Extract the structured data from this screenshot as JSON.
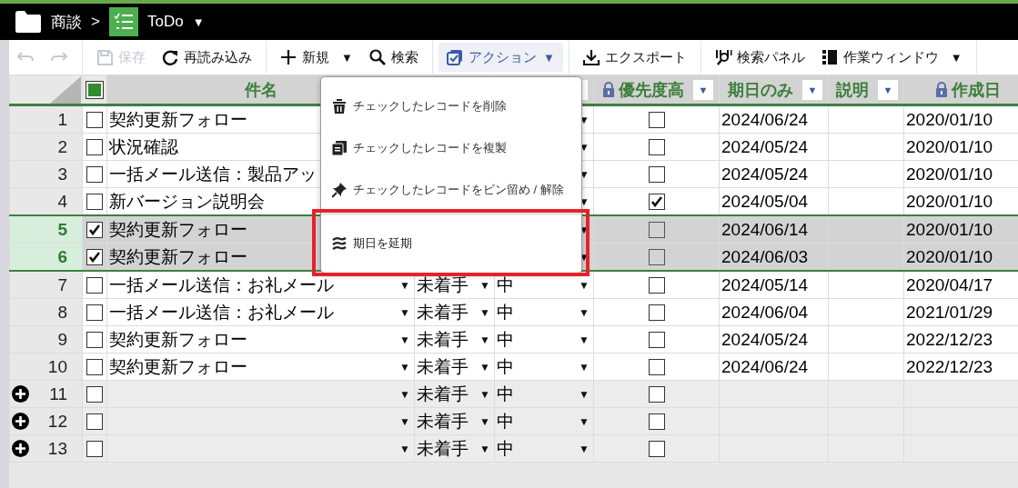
{
  "breadcrumb": {
    "site": "商談",
    "separator": ">",
    "table": "ToDo",
    "caret": "▼"
  },
  "toolbar": [
    {
      "kind": "undo",
      "disabled": true
    },
    {
      "kind": "redo",
      "disabled": true,
      "sep_after": true
    },
    {
      "kind": "save",
      "label": "保存",
      "disabled": true
    },
    {
      "kind": "reload",
      "label": "再読み込み",
      "disabled": false,
      "sep_after": true
    },
    {
      "kind": "new",
      "label": "新規",
      "caret": "▼",
      "disabled": false
    },
    {
      "kind": "search",
      "label": "検索",
      "disabled": false,
      "sep_after": true
    },
    {
      "kind": "action",
      "label": "アクション",
      "caret": "▼",
      "disabled": false,
      "active": true,
      "sep_after": true
    },
    {
      "kind": "export",
      "label": "エクスポート",
      "disabled": false,
      "sep_after": true
    },
    {
      "kind": "panel",
      "label": "検索パネル",
      "disabled": false
    },
    {
      "kind": "window",
      "label": "作業ウィンドウ",
      "caret": "▼",
      "disabled": false,
      "sep_after": true
    }
  ],
  "header_checkbox": {
    "partial": true
  },
  "columns": [
    {
      "kind": "name",
      "label": "件名"
    },
    {
      "kind": "status"
    },
    {
      "kind": "priority",
      "filter": true
    },
    {
      "kind": "flag",
      "label": "優先度高",
      "filter": true,
      "locked": true
    },
    {
      "kind": "due",
      "label": "期日のみ",
      "filter": true
    },
    {
      "kind": "desc",
      "label": "説明",
      "filter": true
    },
    {
      "kind": "created",
      "label": "作成日",
      "locked": true
    }
  ],
  "rows": [
    {
      "number": "1",
      "checked": false,
      "selected": false,
      "new": false,
      "name": "契約更新フォロー",
      "flag": false,
      "due": "2024/06/24",
      "created": "2020/01/10"
    },
    {
      "number": "2",
      "checked": false,
      "selected": false,
      "new": false,
      "name": "状況確認",
      "flag": false,
      "due": "2024/05/24",
      "created": "2020/01/10"
    },
    {
      "number": "3",
      "checked": false,
      "selected": false,
      "new": false,
      "name": "一括メール送信：製品アッ",
      "flag": false,
      "due": "2024/05/24",
      "created": "2020/01/10"
    },
    {
      "number": "4",
      "checked": false,
      "selected": false,
      "new": false,
      "name": "新バージョン説明会",
      "flag": true,
      "due": "2024/05/04",
      "created": "2020/01/10"
    },
    {
      "number": "5",
      "checked": true,
      "selected": true,
      "new": false,
      "name": "契約更新フォロー",
      "flag": false,
      "due": "2024/06/14",
      "created": "2020/01/10"
    },
    {
      "number": "6",
      "checked": true,
      "selected": true,
      "new": false,
      "name": "契約更新フォロー",
      "flag": false,
      "due": "2024/06/03",
      "created": "2020/01/10"
    },
    {
      "number": "7",
      "checked": false,
      "selected": false,
      "new": false,
      "name": "一括メール送信：お礼メール",
      "status": "未着手",
      "priority": "中",
      "flag": false,
      "due": "2024/05/14",
      "created": "2020/04/17"
    },
    {
      "number": "8",
      "checked": false,
      "selected": false,
      "new": false,
      "name": "一括メール送信：お礼メール",
      "status": "未着手",
      "priority": "中",
      "flag": false,
      "due": "2024/06/04",
      "created": "2021/01/29"
    },
    {
      "number": "9",
      "checked": false,
      "selected": false,
      "new": false,
      "name": "契約更新フォロー",
      "status": "未着手",
      "priority": "中",
      "flag": false,
      "due": "2024/05/24",
      "created": "2022/12/23"
    },
    {
      "number": "10",
      "checked": false,
      "selected": false,
      "new": false,
      "name": "契約更新フォロー",
      "status": "未着手",
      "priority": "中",
      "flag": false,
      "due": "2024/06/24",
      "created": "2022/12/23"
    },
    {
      "number": "11",
      "checked": false,
      "selected": false,
      "new": true,
      "status": "未着手",
      "priority": "中",
      "flag": false
    },
    {
      "number": "12",
      "checked": false,
      "selected": false,
      "new": true,
      "status": "未着手",
      "priority": "中",
      "flag": false
    },
    {
      "number": "13",
      "checked": false,
      "selected": false,
      "new": true,
      "status": "未着手",
      "priority": "中",
      "flag": false
    }
  ],
  "dropdown_arrow": "▼",
  "action_menu": {
    "items": [
      {
        "kind": "delete",
        "label": "チェックしたレコードを削除"
      },
      {
        "kind": "copy",
        "label": "チェックしたレコードを複製"
      },
      {
        "kind": "pin",
        "label": "チェックしたレコードをピン留め / 解除"
      },
      {
        "kind": "extend",
        "label": "期日を延期",
        "sep_before": true,
        "highlighted": true
      }
    ]
  }
}
